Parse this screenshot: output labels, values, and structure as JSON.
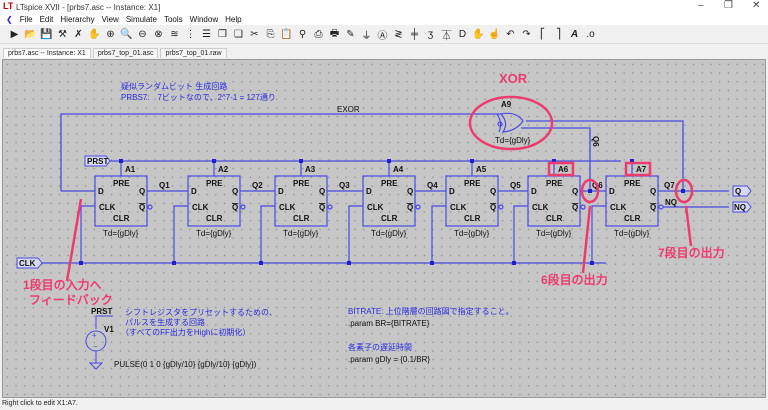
{
  "window": {
    "title": "LTspice XVII - [prbs7.asc -- Instance: X1]",
    "minimize": "–",
    "maximize": "❐",
    "close": "✕"
  },
  "menu": [
    "File",
    "Edit",
    "Hierarchy",
    "View",
    "Simulate",
    "Tools",
    "Window",
    "Help"
  ],
  "tabs": [
    "prbs7.asc -- Instance: X1",
    "prbs7_top_01.asc",
    "prbs7_top_01.raw"
  ],
  "schematic": {
    "comment1": "疑似ランダムビット 生成回路",
    "comment2": "PRBS7:　7ビットなので、2^7-1 = 127通り",
    "exor_net": "EXOR",
    "prst": "PRST",
    "clk": "CLK",
    "flipflops": [
      {
        "name": "A1",
        "out": "Q1"
      },
      {
        "name": "A2",
        "out": "Q2"
      },
      {
        "name": "A3",
        "out": "Q3"
      },
      {
        "name": "A4",
        "out": "Q4"
      },
      {
        "name": "A5",
        "out": "Q5"
      },
      {
        "name": "A6",
        "out": "Q6"
      },
      {
        "name": "A7",
        "out": "Q7"
      }
    ],
    "ff_pins": {
      "pre": "PRE",
      "clr": "CLR",
      "d": "D",
      "q": "Q",
      "qb": "Q",
      "clk": "CLK"
    },
    "td": "Td={gDly}",
    "xor": {
      "name": "A9",
      "td": "Td={gDly}"
    },
    "out_q": "Q",
    "out_nq": "NQ",
    "nq_label": "NQ",
    "v1": {
      "net": "PRST",
      "name": "V1",
      "value": "PULSE(0 1 0 {gDly/10} {gDly/10} {gDly})"
    },
    "pulse_comment": [
      "シフトレジスタをプリセットするための、",
      "パルスを生成する回路",
      "（すべてのFF出力をHighに初期化）"
    ],
    "bitrate_comment": "BITRATE: 上位階層の回路図で指定すること。",
    "param_br": ".param BR={BITRATE}",
    "delay_comment": "各素子の遅延時間",
    "param_gdly": ".param gDly = {0.1/BR}"
  },
  "annotations": {
    "xor": "XOR",
    "feedback1": "1段目の入力へ",
    "feedback2": "フィードバック",
    "out6": "6段目の出力",
    "out7": "7段目の出力",
    "color": "#ee3b6e"
  },
  "status": "Right click to edit X1:A7."
}
